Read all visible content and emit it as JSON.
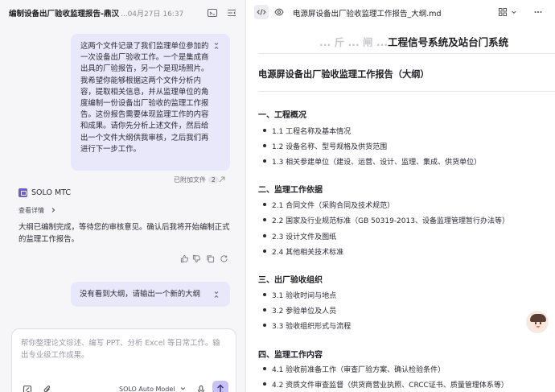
{
  "left_panel": {
    "header": {
      "title": "编制设备出厂验收监理报告-鼎汉",
      "date": "...04月27日 16:37"
    },
    "messages": [
      {
        "role": "user",
        "text": "这两个文件记录了我们监理单位参加的一次设备出厂验收工作。一个是集成商出具的厂验报告，另一个是现场照片。我希望你能够根据这两个文件分析内容，提取相关信息，并从监理单位的角度编制一份设备出厂验收的监理工作报告。这份报告需要体现监理工作的内容和成果。请你先分析上述文件，然后给出一个文件大纲供我审核，之后我们再进行下一步工作。",
        "attached_label": "已附加文件",
        "attached_count": "2"
      },
      {
        "role": "agent",
        "name": "SOLO MTC",
        "details_label": "查看详情",
        "text": "大纲已编制完成，等待您的审核意见。确认后我将开始编制正式的监理工作报告。"
      },
      {
        "role": "user",
        "text": "没有看到大纲，请输出一个新的大纲"
      }
    ],
    "input": {
      "placeholder": "帮你整理论文综述、编写 PPT、分析 Excel 等日常工作。输出专业级工作成果。",
      "model_label": "SOLO Auto Model"
    }
  },
  "right_panel": {
    "toolbar": {
      "doc_title": "电源屏设备出厂验收监理工作报告_大纲.md"
    },
    "doc": {
      "partial_heading": "工程信号系统及站台门系统",
      "partial_heading_cut": "... 斤 ... 闸 ...",
      "title": "电源屏设备出厂验收监理工作报告（大纲）",
      "sections": [
        {
          "heading": "一、工程概况",
          "items": [
            "1.1 工程名称及基本情况",
            "1.2 设备名称、型号规格及供货范围",
            "1.3 相关参建单位（建设、运营、设计、监理、集成、供货单位）"
          ]
        },
        {
          "heading": "二、监理工作依据",
          "items": [
            "2.1 合同文件（采购合同及技术规范）",
            "2.2 国家及行业规范标准（GB 50319-2013、设备监理管理暂行办法等）",
            "2.3 设计文件及图纸",
            "2.4 其他相关技术标准"
          ]
        },
        {
          "heading": "三、出厂验收组织",
          "items": [
            "3.1 验收时间与地点",
            "3.2 参验单位及人员",
            "3.3 验收组织形式与流程"
          ]
        },
        {
          "heading": "四、监理工作内容",
          "items": [
            "4.1 验收前准备工作（审查厂验方案、确认检验条件）",
            "4.2 资质文件审查监督（供货商营业执照、CRCC证书、质量管理体系等）"
          ]
        }
      ]
    }
  },
  "icons": {
    "header": [
      "terminal-icon",
      "collapse-panel-icon"
    ],
    "feedback": [
      "thumbs-up-icon",
      "thumbs-down-icon",
      "copy-icon",
      "refresh-icon"
    ],
    "input": [
      "tool-icon",
      "attach-icon",
      "microphone-icon",
      "send-icon"
    ],
    "toolbar": [
      "code-icon",
      "eye-icon",
      "grid-icon",
      "more-icon"
    ]
  },
  "colors": {
    "accent": "#6d5bd0",
    "user_bubble": "#e9e8fb",
    "send_button": "#c6c1f6",
    "left_bg": "#f6f6f8"
  }
}
